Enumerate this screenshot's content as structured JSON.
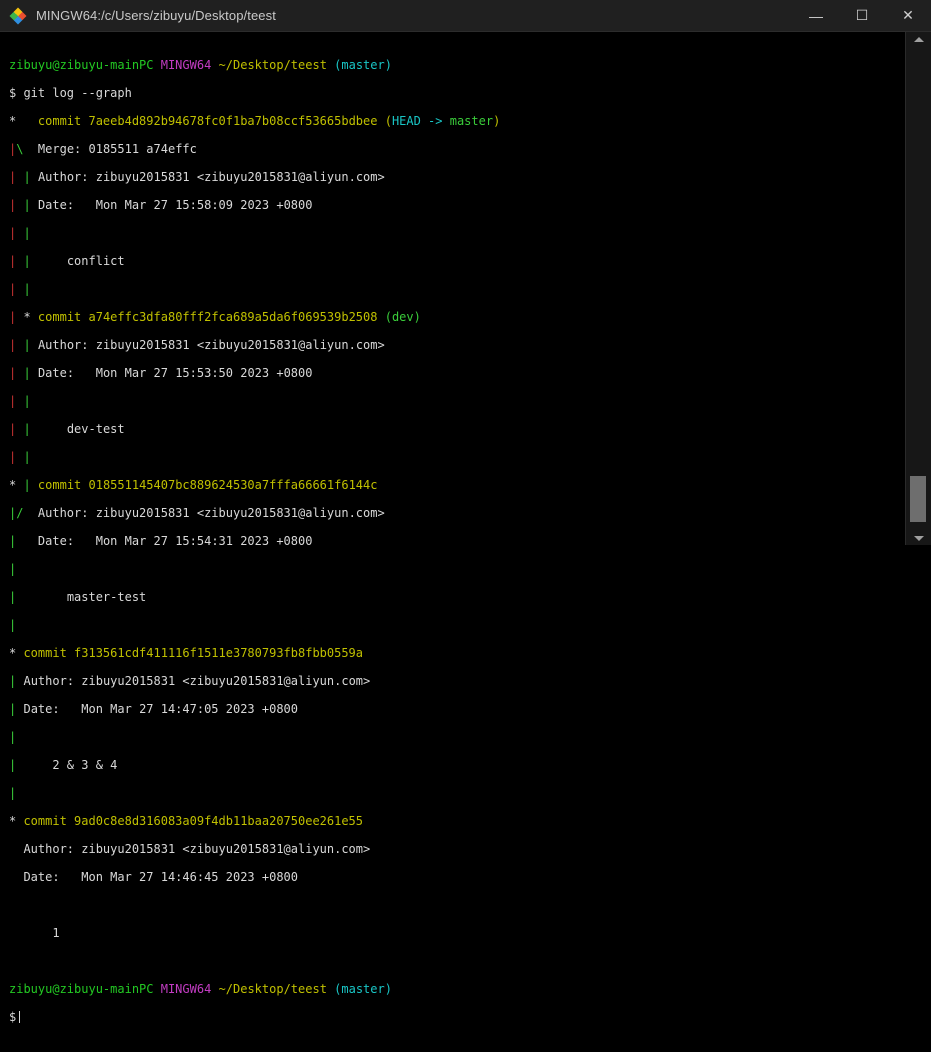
{
  "window": {
    "title": "MINGW64:/c/Users/zibuyu/Desktop/teest",
    "minimize_glyph": "—",
    "maximize_glyph": "☐",
    "close_glyph": "✕",
    "icon": "git-bash-icon"
  },
  "colors": {
    "background": "#000000",
    "green": "#23c923",
    "magenta": "#c33cc3",
    "yellow": "#c0c000",
    "cyan": "#19c6c6",
    "red": "#c43232",
    "text": "#d9d9d9"
  },
  "terminal": {
    "prompt1": {
      "user": "zibuyu@zibuyu-mainPC",
      "env": "MINGW64",
      "path": "~/Desktop/teest",
      "branch": "(master)"
    },
    "command": "$ git log --graph",
    "log": {
      "c1_hash": "commit 7aeeb4d892b94678fc0f1ba7b08ccf53665bdbee",
      "c1_ref_open": "(",
      "c1_ref_head": "HEAD -> ",
      "c1_ref_branch": "master",
      "c1_ref_close": ")",
      "c1_merge": "Merge: 0185511 a74effc",
      "c1_author": "Author: zibuyu2015831 <zibuyu2015831@aliyun.com>",
      "c1_date": "Date:   Mon Mar 27 15:58:09 2023 +0800",
      "c1_msg": "conflict",
      "c2_hash": "commit a74effc3dfa80fff2fca689a5da6f069539b2508",
      "c2_ref": "(dev)",
      "c2_author": "Author: zibuyu2015831 <zibuyu2015831@aliyun.com>",
      "c2_date": "Date:   Mon Mar 27 15:53:50 2023 +0800",
      "c2_msg": "dev-test",
      "c3_hash": "commit 018551145407bc889624530a7fffa66661f6144c",
      "c3_author": "Author: zibuyu2015831 <zibuyu2015831@aliyun.com>",
      "c3_date": "Date:   Mon Mar 27 15:54:31 2023 +0800",
      "c3_msg": "master-test",
      "c4_hash": "commit f313561cdf411116f1511e3780793fb8fbb0559a",
      "c4_author": "Author: zibuyu2015831 <zibuyu2015831@aliyun.com>",
      "c4_date": "Date:   Mon Mar 27 14:47:05 2023 +0800",
      "c4_msg": "2 & 3 & 4",
      "c5_hash": "commit 9ad0c8e8d316083a09f4db11baa20750ee261e55",
      "c5_author": "Author: zibuyu2015831 <zibuyu2015831@aliyun.com>",
      "c5_date": "Date:   Mon Mar 27 14:46:45 2023 +0800",
      "c5_msg": "1"
    },
    "prompt2": {
      "user": "zibuyu@zibuyu-mainPC",
      "env": "MINGW64",
      "path": "~/Desktop/teest",
      "branch": "(master)"
    },
    "prompt_symbol": "$"
  }
}
